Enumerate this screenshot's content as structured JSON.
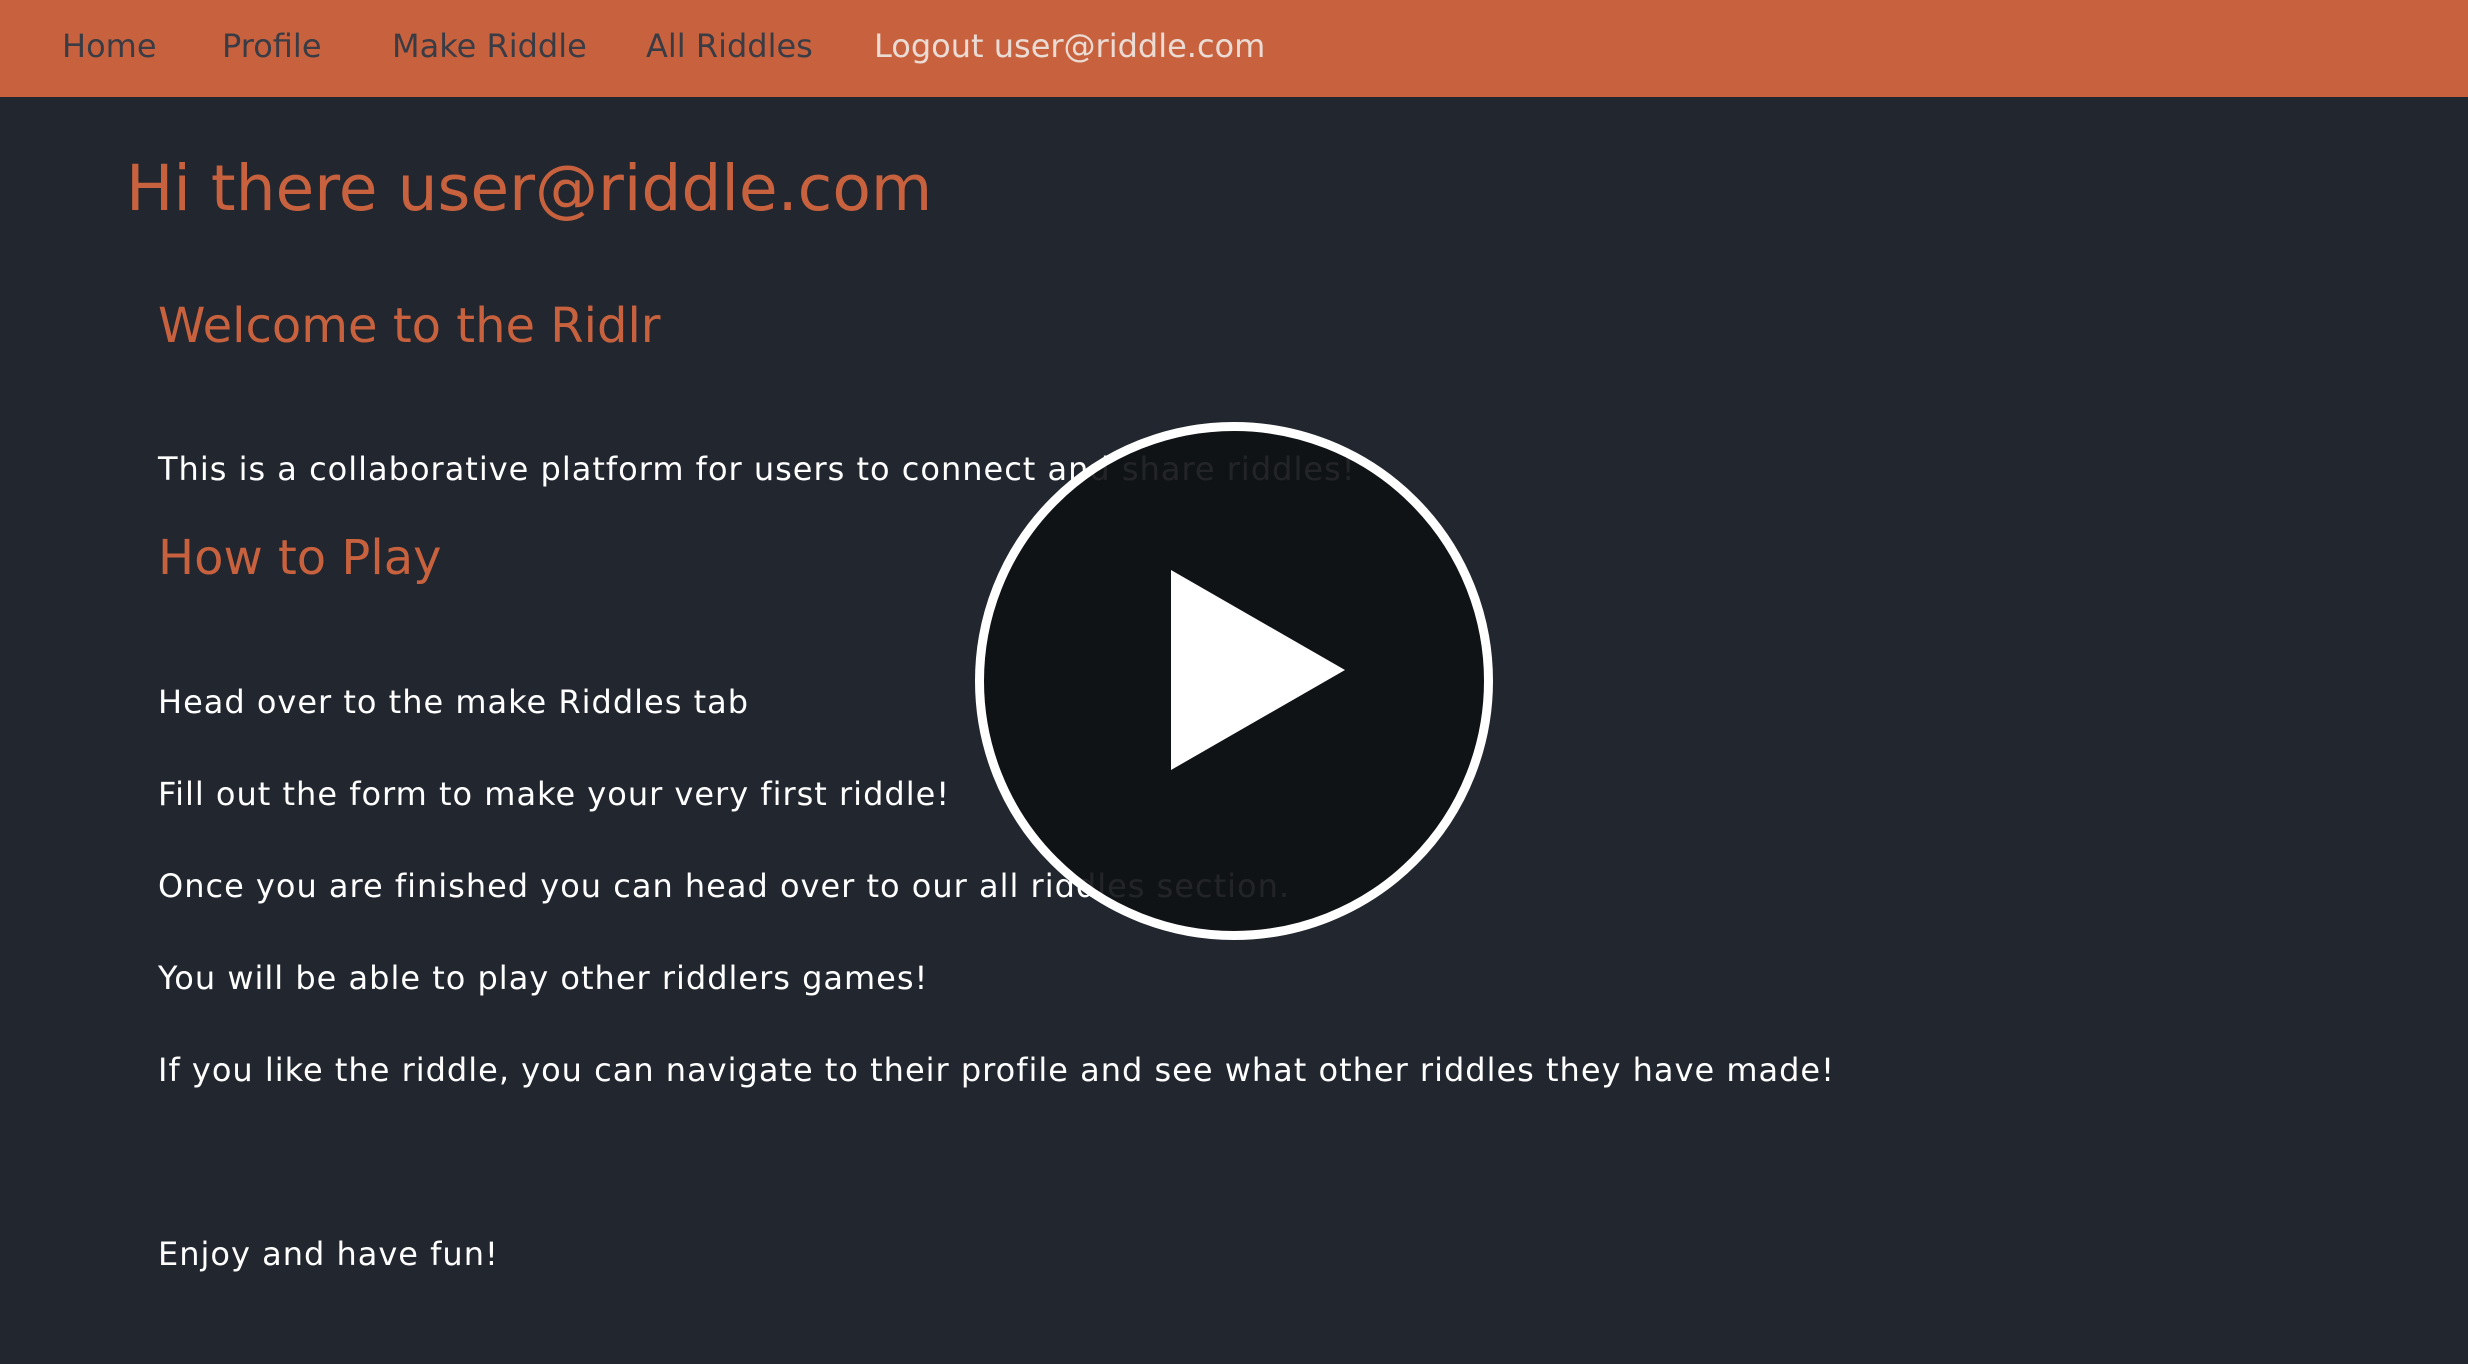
{
  "nav": {
    "home": "Home",
    "profile": "Profile",
    "make_riddle": "Make Riddle",
    "all_riddles": "All Riddles",
    "logout": "Logout user@riddle.com"
  },
  "main": {
    "greeting": "Hi there user@riddle.com",
    "welcome_heading": "Welcome to the Ridlr",
    "intro": "This is a collaborative platform for users to connect and share riddles!",
    "how_to_heading": "How to Play",
    "steps": [
      "Head over to the make Riddles tab",
      "Fill out the form to make your very first riddle!",
      "Once you are finished you can head over to our all riddles section.",
      "You will be able to play other riddlers games!",
      "If you like the riddle, you can navigate to their profile and see what other riddles they have made!"
    ],
    "closing": "Enjoy and have fun!"
  },
  "overlay": {
    "icon": "play-icon"
  },
  "colors": {
    "accent": "#c8623e",
    "background": "#22262f",
    "text": "#ffffff",
    "nav_text": "#3a3c45"
  }
}
